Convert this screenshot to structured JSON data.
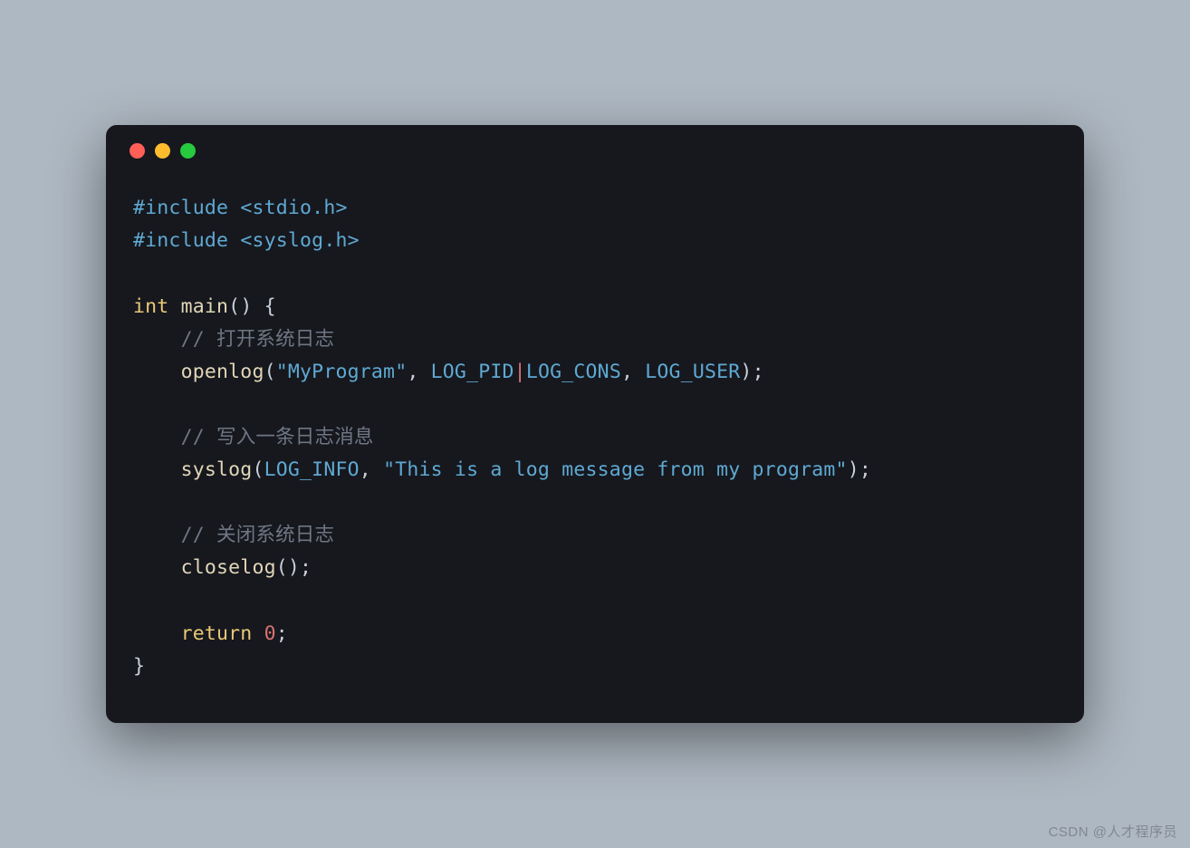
{
  "window": {
    "dot_colors": {
      "red": "#ff5f56",
      "yellow": "#ffbd2e",
      "green": "#27c93f"
    }
  },
  "code": {
    "line1": {
      "directive": "#include",
      "path": "<stdio.h>"
    },
    "line2": {
      "directive": "#include",
      "path": "<syslog.h>"
    },
    "line4": {
      "type": "int",
      "func": "main",
      "parens": "()",
      "brace": " {"
    },
    "line5": {
      "comment": "// 打开系统日志"
    },
    "line6": {
      "call": "openlog",
      "open": "(",
      "arg1": "\"MyProgram\"",
      "comma1": ", ",
      "arg2a": "LOG_PID",
      "pipe": "|",
      "arg2b": "LOG_CONS",
      "comma2": ", ",
      "arg3": "LOG_USER",
      "close": ");"
    },
    "line8": {
      "comment": "// 写入一条日志消息"
    },
    "line9": {
      "call": "syslog",
      "open": "(",
      "arg1": "LOG_INFO",
      "comma1": ", ",
      "arg2": "\"This is a log message from my program\"",
      "close": ");"
    },
    "line11": {
      "comment": "// 关闭系统日志"
    },
    "line12": {
      "call": "closelog",
      "open": "(",
      "close": ");"
    },
    "line14": {
      "kw": "return",
      "sp": " ",
      "num": "0",
      "semi": ";"
    },
    "line15": {
      "brace": "}"
    }
  },
  "watermark": "CSDN @人才程序员"
}
